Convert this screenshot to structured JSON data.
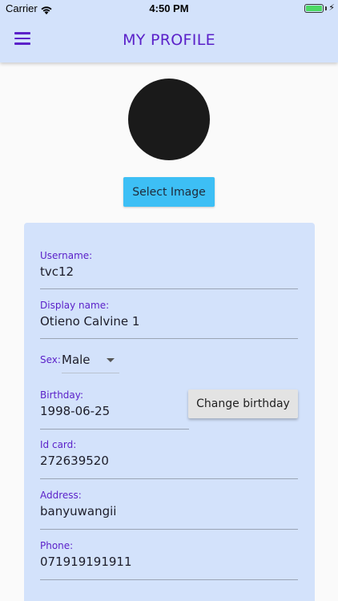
{
  "status_bar": {
    "carrier": "Carrier",
    "time": "4:50 PM",
    "battery_level": 1.0
  },
  "header": {
    "title": "MY PROFILE"
  },
  "avatar": {
    "select_image_label": "Select Image"
  },
  "form": {
    "username": {
      "label": "Username:",
      "value": "tvc12"
    },
    "display_name": {
      "label": "Display name:",
      "value": "Otieno Calvine 1"
    },
    "sex": {
      "label": "Sex:",
      "value": "Male"
    },
    "birthday": {
      "label": "Birthday:",
      "value": "1998-06-25",
      "button_label": "Change birthday"
    },
    "id_card": {
      "label": "Id card:",
      "value": "272639520"
    },
    "address": {
      "label": "Address:",
      "value": "banyuwangii"
    },
    "phone": {
      "label": "Phone:",
      "value": "071919191911"
    }
  },
  "colors": {
    "accent": "#5b21c9",
    "header_bg": "#d3e2fb",
    "button_blue": "#3dbff5"
  }
}
